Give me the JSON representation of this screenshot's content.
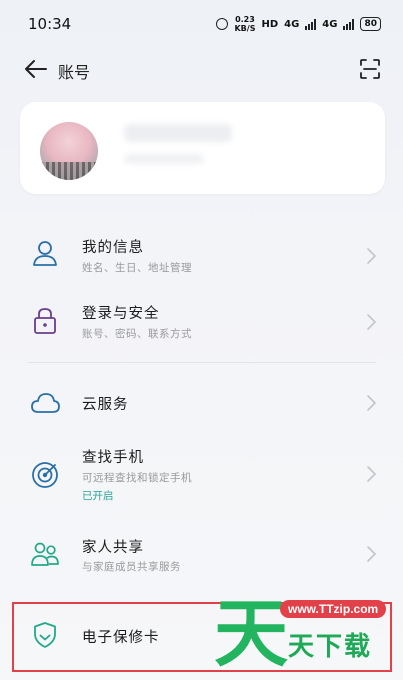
{
  "status_bar": {
    "time": "10:34",
    "net_speed_value": "0.23",
    "net_speed_unit": "KB/S",
    "hd_label": "HD",
    "net_type_1": "4G",
    "net_type_2": "4G",
    "battery": "80"
  },
  "header": {
    "title": "账号",
    "back_icon": "arrow-left-icon",
    "scan_icon": "scan-icon"
  },
  "menu": {
    "my_info": {
      "title": "我的信息",
      "subtitle": "姓名、生日、地址管理"
    },
    "login_security": {
      "title": "登录与安全",
      "subtitle": "账号、密码、联系方式"
    },
    "cloud_service": {
      "title": "云服务"
    },
    "find_phone": {
      "title": "查找手机",
      "subtitle": "可远程查找和锁定手机",
      "status": "已开启"
    },
    "family_share": {
      "title": "家人共享",
      "subtitle": "与家庭成员共享服务"
    },
    "e_warranty": {
      "title": "电子保修卡"
    }
  },
  "watermark": {
    "url": "www.TTzip.com",
    "text": "天下载",
    "big_char": "天"
  },
  "colors": {
    "accent_teal": "#2aa59a",
    "highlight_red": "#e2414a",
    "watermark_green": "#22b45f"
  }
}
